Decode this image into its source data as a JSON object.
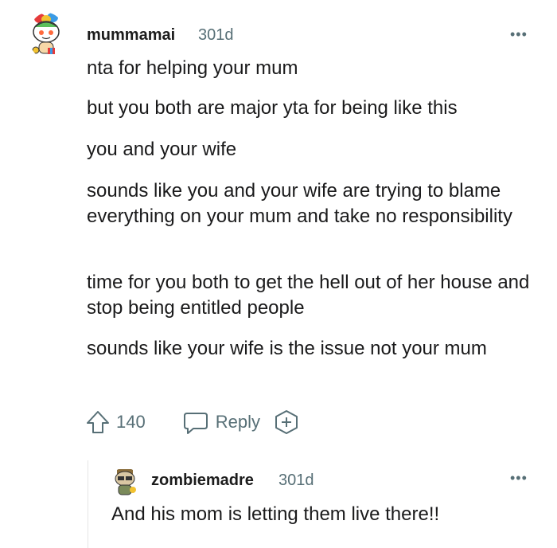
{
  "comment": {
    "username": "mummamai",
    "time": "301d",
    "paragraphs": [
      "nta for helping your mum",
      "but you both are major yta for being like this",
      "you and your wife",
      "sounds like you and your wife are trying to blame everything on your mum and take no responsibility",
      "time for you both to get the hell out of her house and stop being entitled people",
      "sounds like your wife is the issue not your mum"
    ],
    "upvotes": "140",
    "reply_label": "Reply",
    "more_label": "•••"
  },
  "reply": {
    "username": "zombiemadre",
    "time": "301d",
    "text": "And his mom is letting them live there!!",
    "more_label": "•••"
  },
  "icons": {
    "upvote": "upvote-arrow-icon",
    "reply": "speech-bubble-icon",
    "award": "plus-circle-icon",
    "more": "more-dots-icon"
  },
  "colors": {
    "meta": "#576f76",
    "text": "#1a1a1b",
    "thread_line": "#e5e5e5"
  }
}
